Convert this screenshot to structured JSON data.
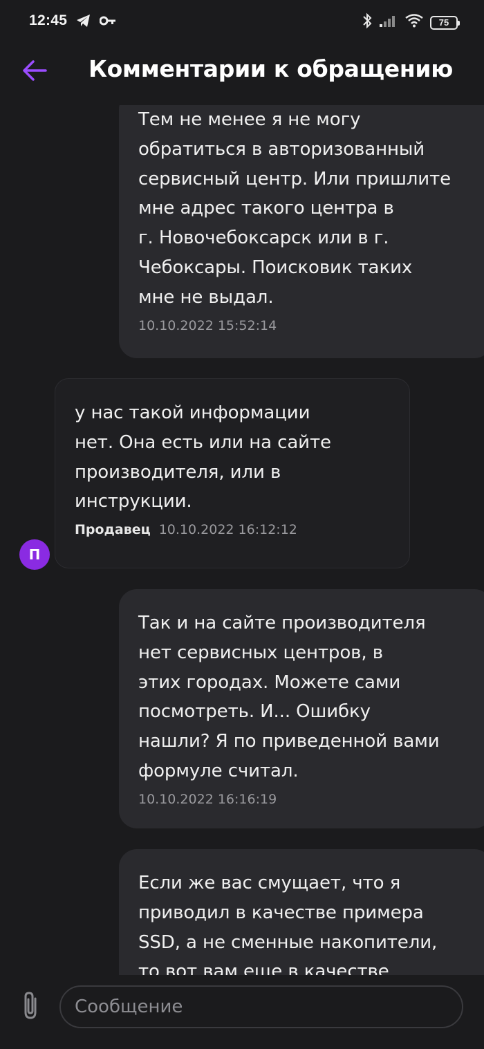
{
  "status_bar": {
    "time": "12:45",
    "battery": "75",
    "icons": [
      "telegram-icon",
      "key-icon",
      "bluetooth-icon",
      "signal-icon",
      "wifi-icon",
      "battery-icon"
    ]
  },
  "header": {
    "title": "Комментарии к обращению",
    "back_icon": "arrow-left-icon",
    "accent_color": "#9b4dff"
  },
  "messages": [
    {
      "type": "own",
      "text": "Тем не менее я не могу\nобратиться в авторизованный\nсервисный центр. Или пришлите\nмне адрес такого центра в\nг. Новочебоксарск или в г.\nЧебоксары. Поисковик таких\nмне не выдал.",
      "timestamp": "10.10.2022 15:52:14"
    },
    {
      "type": "incoming",
      "text": "у нас такой информации\nнет. Она есть или на сайте\nпроизводителя, или в\nинструкции.",
      "sender": "Продавец",
      "timestamp": "10.10.2022 16:12:12",
      "avatar_letter": "П",
      "avatar_color": "#8a2be2"
    },
    {
      "type": "own",
      "text": "Так и на сайте производителя\nнет сервисных центров, в\nэтих городах. Можете сами\nпосмотреть. И... Ошибку\nнашли? Я по приведенной вами\nформуле считал.",
      "timestamp": "10.10.2022 16:16:19"
    },
    {
      "type": "own",
      "text": "Если же вас смущает, что я\nприводил в качестве примера\nSSD, а не сменные накопители,\nто вот вам еще в качестве",
      "timestamp": ""
    }
  ],
  "input": {
    "placeholder": "Сообщение",
    "value": "",
    "attach_icon": "paperclip-icon"
  }
}
